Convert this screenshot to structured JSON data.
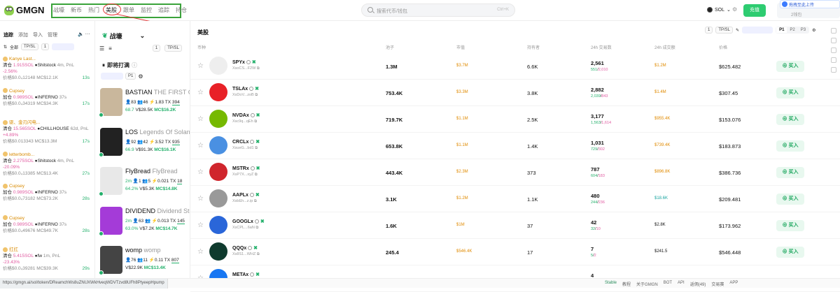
{
  "nav": {
    "brand": "GMGN",
    "items": [
      "战壕",
      "新币",
      "热门",
      "美股",
      "跟单",
      "监控",
      "追踪",
      "持仓"
    ],
    "search_placeholder": "搜索代币/钱包",
    "search_shortcut": "Ctrl+K",
    "chain": "SOL",
    "charge": "充值",
    "upload": "拖拽至此上传",
    "wallet_count": "2钱包"
  },
  "left": {
    "tabs": [
      "追踪",
      "添加",
      "导入",
      "管理"
    ],
    "filter_all": "全部",
    "tpsl": "TP/SL",
    "page": "1",
    "trades": [
      {
        "user": "Kanye Last...",
        "action": "清仓",
        "amount": "1.915SOL",
        "token": "Shitstock",
        "time": "4m",
        "pnl": ", PnL",
        "pnlv": "-2.56%",
        "price": "价格$0.0₄12148",
        "mc": "MC$12.1K",
        "ago": "13s"
      },
      {
        "user": "Cupsey",
        "action": "加仓",
        "amount": "0.989SOL",
        "token": "INFERNO",
        "time": "37s",
        "pnl": "",
        "pnlv": "",
        "price": "价格$0.0₄34319",
        "mc": "MC$34.3K",
        "ago": "17s"
      },
      {
        "user": "驱、金刃闪电...",
        "action": "清仓",
        "amount": "15.565SOL",
        "token": "CHILLHOUSE",
        "time": "62d",
        "pnl": ", PnL",
        "pnlv": "+4.89%",
        "price": "价格$0.013343",
        "mc": "MC$13.3M",
        "ago": "17s"
      },
      {
        "user": "letterbomb...",
        "action": "清仓",
        "amount": "2.275SOL",
        "token": "Shitstock",
        "time": "4m",
        "pnl": ", PnL",
        "pnlv": "-20.09%",
        "price": "价格$0.0₄13385",
        "mc": "MC$13.4K",
        "ago": "27s"
      },
      {
        "user": "Cupsey",
        "action": "加仓",
        "amount": "0.989SOL",
        "token": "INFERNO",
        "time": "37s",
        "pnl": "",
        "pnlv": "",
        "price": "价格$0.0₄73182",
        "mc": "MC$73.2K",
        "ago": "28s"
      },
      {
        "user": "Cupsey",
        "action": "加仓",
        "amount": "0.989SOL",
        "token": "INFERNO",
        "time": "37s",
        "pnl": "",
        "pnlv": "",
        "price": "价格$0.0₄49676",
        "mc": "MC$49.7K",
        "ago": "28s"
      },
      {
        "user": "扛扛",
        "action": "清仓",
        "amount": "5.415SOL",
        "token": "fw",
        "time": "1m",
        "pnl": ", PnL",
        "pnlv": "-23.43%",
        "price": "价格$0.0₄39281",
        "mc": "MC$39.3K",
        "ago": "29s"
      }
    ]
  },
  "mid": {
    "title": "战壕",
    "tpsl": "TP/SL",
    "upcoming": "即将打满",
    "page": "P1",
    "tokens": [
      {
        "sym": "BASTIAN",
        "full": "THE FIRST CR",
        "age": "",
        "h": "83",
        "w": "46",
        "f": "1.83",
        "tx": "394",
        "pct": "68.7",
        "v": "V$28.5K",
        "mc": "MC$16.2K"
      },
      {
        "sym": "LOS",
        "full": "Legends Of Solana",
        "age": "",
        "h": "92",
        "w": "42",
        "f": "3.52",
        "tx": "935",
        "pct": "66.9",
        "v": "V$91.3K",
        "mc": "MC$16.1K"
      },
      {
        "sym": "FlyBread",
        "full": "FlyBread",
        "age": "2m",
        "h": "1",
        "w": "5",
        "f": "0.021",
        "tx": "18",
        "pct": "64.2%",
        "v": "V$5.3K",
        "mc": "MC$14.8K"
      },
      {
        "sym": "DIVIDEND",
        "full": "Dividend Sto",
        "age": "2m",
        "h": "63",
        "w": "",
        "f": "0.013",
        "tx": "145",
        "pct": "63.0%",
        "v": "V$7.2K",
        "mc": "MC$14.7K"
      },
      {
        "sym": "womp",
        "full": "womp",
        "age": "",
        "h": "76",
        "w": "11",
        "f": "0.11",
        "tx": "807",
        "pct": "",
        "v": "V$22.9K",
        "mc": "MC$13.4K"
      }
    ]
  },
  "main": {
    "title": "美股",
    "tpsl": "TP/SL",
    "page_btn": "1",
    "pages": [
      "P1",
      "P2",
      "P3"
    ],
    "headers": [
      "币种",
      "池子",
      "市值",
      "持有者",
      "24h 交易数",
      "24h 成交额",
      "价格"
    ],
    "buy_label": "买入",
    "rows": [
      {
        "sym": "SPYx",
        "addr": "XsoCS...F2W",
        "liq": "1.3M",
        "mcap": "$3.7M",
        "holders": "6.6K",
        "tx": "2,561",
        "b": "551",
        "s": "2,010",
        "vol": "$1.2M",
        "price": "$625.482",
        "mc_color": "#e08a00",
        "vol_color": "#e08a00",
        "logo": "#eee"
      },
      {
        "sym": "TSLAx",
        "addr": "XsDoV...zoB",
        "liq": "753.4K",
        "mcap": "$3.3M",
        "holders": "3.8K",
        "tx": "2,882",
        "b": "2,039",
        "s": "843",
        "vol": "$1.4M",
        "price": "$307.45",
        "mc_color": "#e08a00",
        "vol_color": "#e08a00",
        "logo": "#e82127"
      },
      {
        "sym": "NVDAx",
        "addr": "Xsc9q...qEh",
        "liq": "719.7K",
        "mcap": "$1.1M",
        "holders": "2.5K",
        "tx": "3,177",
        "b": "1,563",
        "s": "1,614",
        "vol": "$955.4K",
        "price": "$153.076",
        "mc_color": "#e08a00",
        "vol_color": "#e08a00",
        "logo": "#76b900"
      },
      {
        "sym": "CRCLx",
        "addr": "XsueG...bd1",
        "liq": "653.8K",
        "mcap": "$1.1M",
        "holders": "1.4K",
        "tx": "1,031",
        "b": "729",
        "s": "302",
        "vol": "$739.4K",
        "price": "$183.873",
        "mc_color": "#e08a00",
        "vol_color": "#e08a00",
        "logo": "#4a90e2"
      },
      {
        "sym": "MSTRx",
        "addr": "XsP7X...xyZ",
        "liq": "443.4K",
        "mcap": "$2.3M",
        "holders": "373",
        "tx": "787",
        "b": "604",
        "s": "183",
        "vol": "$896.8K",
        "price": "$386.736",
        "mc_color": "#e08a00",
        "vol_color": "#e08a00",
        "logo": "#d0262d"
      },
      {
        "sym": "AAPLx",
        "addr": "XsbEh...z.ip",
        "liq": "3.1K",
        "mcap": "$1.2M",
        "holders": "1.1K",
        "tx": "480",
        "b": "244",
        "s": "236",
        "vol": "$18.6K",
        "price": "$209.481",
        "mc_color": "#e08a00",
        "vol_color": "#1aa5a0",
        "logo": "#999"
      },
      {
        "sym": "GOOGLx",
        "addr": "XsCPL...6aN",
        "liq": "1.6K",
        "mcap": "$1M",
        "holders": "37",
        "tx": "42",
        "b": "32",
        "s": "10",
        "vol": "$2.8K",
        "price": "$173.962",
        "mc_color": "#e08a00",
        "vol_color": "#111",
        "logo": "#2a66d9"
      },
      {
        "sym": "QQQx",
        "addr": "Xs8S1...WHZ",
        "liq": "245.4",
        "mcap": "$546.4K",
        "holders": "17",
        "tx": "7",
        "b": "5",
        "s": "2",
        "vol": "$241.5",
        "price": "$546.448",
        "mc_color": "#e08a00",
        "vol_color": "#111",
        "logo": "#0f3b2e"
      },
      {
        "sym": "METAx",
        "addr": "",
        "liq": "",
        "mcap": "",
        "holders": "",
        "tx": "4",
        "b": "",
        "s": "",
        "vol": "",
        "price": "",
        "mc_color": "#e08a00",
        "vol_color": "#111",
        "logo": "#1877f2"
      }
    ]
  },
  "footer": {
    "url": "https://gmgn.ai/sol/token/DReamchWs8uZNUXWkHveqWDVTzvd8UFh8PtyeepHpump",
    "items": [
      "Stable",
      "教程",
      "关于GMGN",
      "BOT",
      "API",
      "返佣(49)",
      "交易赛",
      "APP"
    ]
  }
}
